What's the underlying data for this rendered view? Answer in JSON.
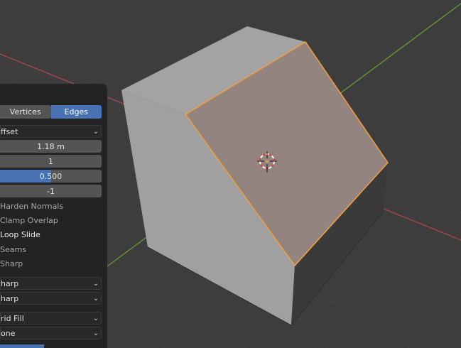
{
  "panel": {
    "mode_tabs": [
      {
        "label": "Vertices",
        "active": false
      },
      {
        "label": "Edges",
        "active": true
      }
    ],
    "width_type": "ffset",
    "amount": "1.18 m",
    "segments": "1",
    "shape": "0.500",
    "shape_fraction": 0.5,
    "material_index": "-1",
    "checkboxes": {
      "harden_normals": "Harden Normals",
      "clamp_overlap": "Clamp Overlap",
      "loop_slide": "Loop Slide",
      "seams": "Seams",
      "sharp": "Sharp"
    },
    "miter_outer": "harp",
    "miter_inner": "harp",
    "fill_type": "rid Fill",
    "face_strength": "one"
  },
  "colors": {
    "accent": "#4772b3",
    "selection": "#f0a040",
    "x_axis": "#c8464d",
    "y_axis": "#7ba33c"
  }
}
